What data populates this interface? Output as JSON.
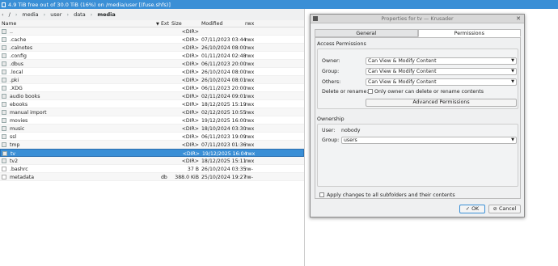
{
  "status_bar": {
    "text": "4.9 TiB free out of 30.0 TiB (16%) on /media/user [(fuse.shfs)]"
  },
  "breadcrumb": {
    "root": "/",
    "items": [
      "media",
      "user",
      "data",
      "media"
    ]
  },
  "columns": {
    "name": "Name",
    "ext": "Ext",
    "size": "Size",
    "modified": "Modified",
    "rwx": "rwx"
  },
  "files": [
    {
      "name": "..",
      "ext": "",
      "size": "<DIR>",
      "modified": "",
      "rwx": "",
      "type": "dir"
    },
    {
      "name": ".cache",
      "ext": "",
      "size": "<DIR>",
      "modified": "07/11/2023 03:44",
      "rwx": "rwx",
      "type": "dir"
    },
    {
      "name": ".calnotes",
      "ext": "",
      "size": "<DIR>",
      "modified": "26/10/2024 08:00",
      "rwx": "rwx",
      "type": "dir"
    },
    {
      "name": ".config",
      "ext": "",
      "size": "<DIR>",
      "modified": "01/11/2024 02:48",
      "rwx": "rwx",
      "type": "dir"
    },
    {
      "name": ".dbus",
      "ext": "",
      "size": "<DIR>",
      "modified": "06/11/2023 20:00",
      "rwx": "rwx",
      "type": "dir"
    },
    {
      "name": ".local",
      "ext": "",
      "size": "<DIR>",
      "modified": "26/10/2024 08:00",
      "rwx": "rwx",
      "type": "dir"
    },
    {
      "name": ".pki",
      "ext": "",
      "size": "<DIR>",
      "modified": "26/10/2024 08:01",
      "rwx": "rwx",
      "type": "dir"
    },
    {
      "name": ".XDG",
      "ext": "",
      "size": "<DIR>",
      "modified": "06/11/2023 20:00",
      "rwx": "rwx",
      "type": "dir"
    },
    {
      "name": "audio books",
      "ext": "",
      "size": "<DIR>",
      "modified": "02/11/2024 09:01",
      "rwx": "rwx",
      "type": "dir"
    },
    {
      "name": "ebooks",
      "ext": "",
      "size": "<DIR>",
      "modified": "18/12/2025 15:19",
      "rwx": "rwx",
      "type": "dir"
    },
    {
      "name": "manual import",
      "ext": "",
      "size": "<DIR>",
      "modified": "02/12/2025 10:55",
      "rwx": "rwx",
      "type": "dir"
    },
    {
      "name": "movies",
      "ext": "",
      "size": "<DIR>",
      "modified": "19/12/2025 16:00",
      "rwx": "rwx",
      "type": "dir"
    },
    {
      "name": "music",
      "ext": "",
      "size": "<DIR>",
      "modified": "18/10/2024 03:30",
      "rwx": "rwx",
      "type": "dir"
    },
    {
      "name": "ssl",
      "ext": "",
      "size": "<DIR>",
      "modified": "06/11/2023 19:09",
      "rwx": "rwx",
      "type": "dir"
    },
    {
      "name": "tmp",
      "ext": "",
      "size": "<DIR>",
      "modified": "07/11/2023 01:36",
      "rwx": "rwx",
      "type": "dir"
    },
    {
      "name": "tv",
      "ext": "",
      "size": "<DIR>",
      "modified": "19/12/2025 16:04",
      "rwx": "rwx",
      "type": "dir",
      "selected": true
    },
    {
      "name": "tv2",
      "ext": "",
      "size": "<DIR>",
      "modified": "18/12/2025 15:11",
      "rwx": "rwx",
      "type": "dir"
    },
    {
      "name": ".bashrc",
      "ext": "",
      "size": "37 B",
      "modified": "26/10/2024 03:35",
      "rwx": "rw-",
      "type": "file"
    },
    {
      "name": "metadata",
      "ext": "db",
      "size": "388.0 KiB",
      "modified": "25/10/2024 19:27",
      "rwx": "rw-",
      "type": "file"
    }
  ],
  "dialog": {
    "title": "Properties for tv — Krusader",
    "close_glyph": "✕",
    "tabs": [
      "General",
      "Permissions"
    ],
    "access_group_title": "Access Permissions",
    "owner_label": "Owner:",
    "owner_value": "Can View & Modify Content",
    "group_label": "Group:",
    "group_value": "Can View & Modify Content",
    "others_label": "Others:",
    "others_value": "Can View & Modify Content",
    "delete_label": "Delete or rename:",
    "delete_checkbox_label": "Only owner can delete or rename contents",
    "advanced_button": "Advanced Permissions",
    "ownership_group_title": "Ownership",
    "user_label": "User:",
    "user_value": "nobody",
    "group2_label": "Group:",
    "group2_value": "users",
    "apply_label": "Apply changes to all subfolders and their contents",
    "ok_label": "OK",
    "cancel_label": "Cancel",
    "ok_glyph": "✓",
    "cancel_glyph": "⊘"
  }
}
